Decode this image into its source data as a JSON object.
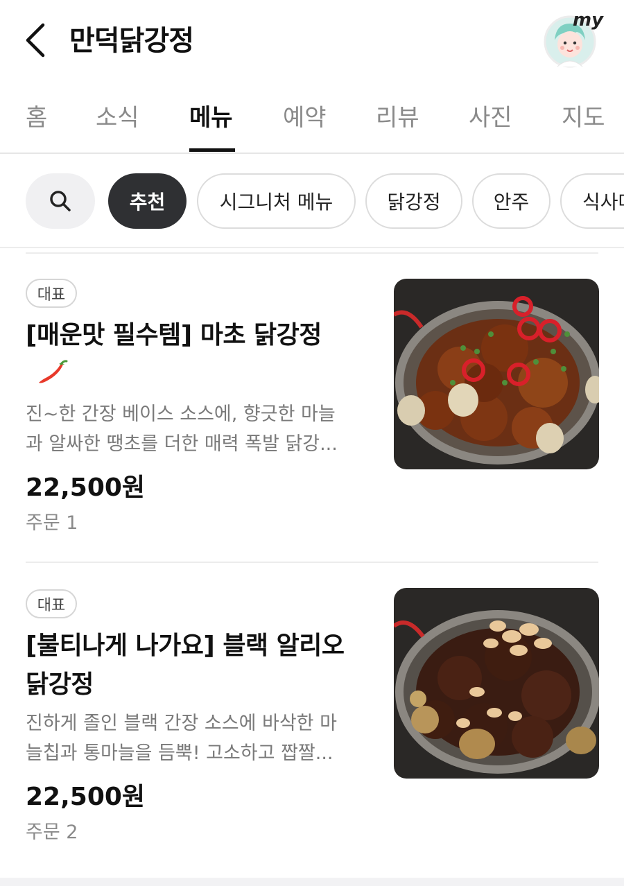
{
  "header": {
    "title": "만덕닭강정",
    "my_label": "my"
  },
  "tabs": [
    {
      "label": "홈",
      "active": false
    },
    {
      "label": "소식",
      "active": false
    },
    {
      "label": "메뉴",
      "active": true
    },
    {
      "label": "예약",
      "active": false
    },
    {
      "label": "리뷰",
      "active": false
    },
    {
      "label": "사진",
      "active": false
    },
    {
      "label": "지도",
      "active": false
    }
  ],
  "filters": {
    "search_icon": "search-icon",
    "chips": [
      {
        "label": "추천",
        "selected": true
      },
      {
        "label": "시그니처 메뉴",
        "selected": false
      },
      {
        "label": "닭강정",
        "selected": false
      },
      {
        "label": "안주",
        "selected": false
      },
      {
        "label": "식사메",
        "selected": false
      }
    ]
  },
  "menu_items": [
    {
      "badge": "대표",
      "name": "[매운맛 필수템] 마초 닭강정",
      "spicy_icon": "chili-pepper-icon",
      "description_line1": "진~한 간장 베이스 소스에, 향긋한 마늘",
      "description_line2": "과 알싸한 땡초를 더한 매력 폭발 닭강...",
      "price": "22,500원",
      "orders": "주문 1"
    },
    {
      "badge": "대표",
      "name_line1": "[불티나게 나가요] 블랙 알리오",
      "name_line2": "닭강정",
      "description_line1": "진하게 졸인 블랙 간장 소스에 바삭한 마",
      "description_line2": "늘칩과 통마늘을 듬뿍! 고소하고 짭짤...",
      "price": "22,500원",
      "orders": "주문 2"
    }
  ],
  "colors": {
    "selected_chip": "#2f3033",
    "tab_active": "#111111",
    "tab_inactive": "#8a8a8a"
  }
}
